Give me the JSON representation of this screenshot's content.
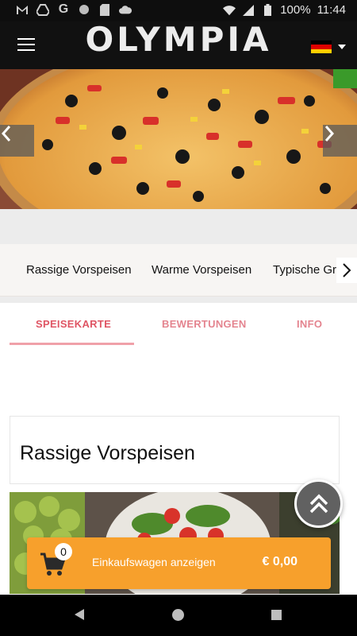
{
  "status_bar": {
    "battery": "100%",
    "time": "11:44",
    "icons": [
      "gmail-icon",
      "drive-icon",
      "google-icon",
      "circle-icon",
      "sd-card-icon",
      "cloud-icon",
      "wifi-icon",
      "signal-icon",
      "battery-icon"
    ]
  },
  "header": {
    "brand": "OLYMPIA",
    "language_flag": "germany-flag-icon"
  },
  "hero": {
    "prev_icon": "chevron-left-icon",
    "next_icon": "chevron-right-icon"
  },
  "categories": {
    "items": [
      "Rassige Vorspeisen",
      "Warme Vorspeisen",
      "Typische Gri"
    ],
    "overflow_letter": "i"
  },
  "tabs": {
    "items": [
      {
        "label": "SPEISEKARTE",
        "active": true
      },
      {
        "label": "BEWERTUNGEN",
        "active": false
      },
      {
        "label": "INFO",
        "active": false
      }
    ]
  },
  "section": {
    "title": "Rassige Vorspeisen"
  },
  "cart": {
    "count": "0",
    "label": "Einkaufswagen anzeigen",
    "total": "€ 0,00"
  },
  "colors": {
    "header_bg": "#111111",
    "accent_tab": "#df5564",
    "cart_bg": "#f7a02c",
    "scroll_button": "#616161"
  }
}
